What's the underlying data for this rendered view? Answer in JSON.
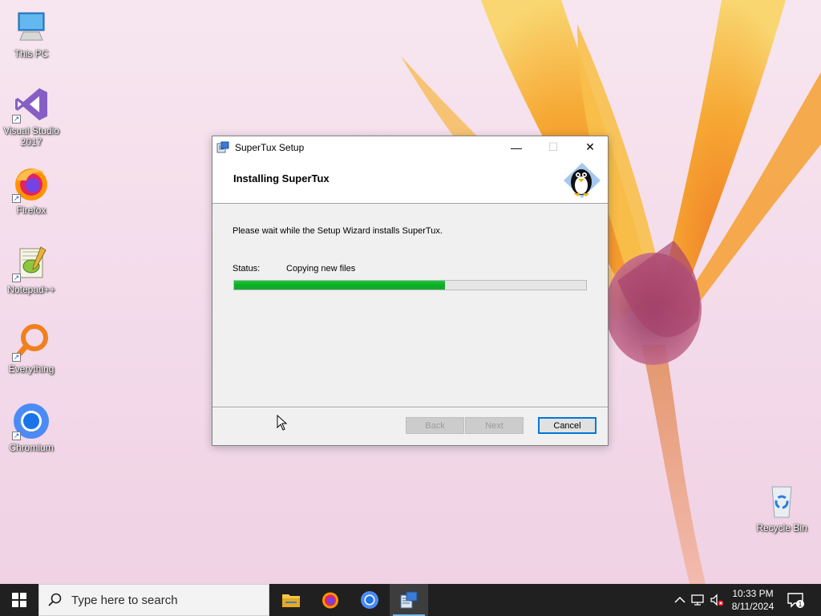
{
  "desktop": {
    "icons": [
      {
        "label": "This PC"
      },
      {
        "label": "Visual Studio 2017"
      },
      {
        "label": "Firefox"
      },
      {
        "label": "Notepad++"
      },
      {
        "label": "Everything"
      },
      {
        "label": "Chromium"
      },
      {
        "label": "Recycle Bin"
      }
    ]
  },
  "dialog": {
    "title": "SuperTux Setup",
    "heading": "Installing SuperTux",
    "description": "Please wait while the Setup Wizard installs SuperTux.",
    "status_label": "Status:",
    "status_value": "Copying new files",
    "progress_percent": 60,
    "buttons": {
      "back": "Back",
      "next": "Next",
      "cancel": "Cancel"
    },
    "window_controls": {
      "minimize": "—",
      "maximize": "☐",
      "close": "✕"
    }
  },
  "taskbar": {
    "search_placeholder": "Type here to search",
    "apps": [
      "file-explorer",
      "firefox",
      "chromium",
      "supertux-setup"
    ],
    "clock": {
      "time": "10:33 PM",
      "date": "8/11/2024"
    },
    "notification_count": "1"
  },
  "colors": {
    "progress_fill": "#06b025",
    "taskbar": "#202020",
    "accent": "#0078d7"
  }
}
